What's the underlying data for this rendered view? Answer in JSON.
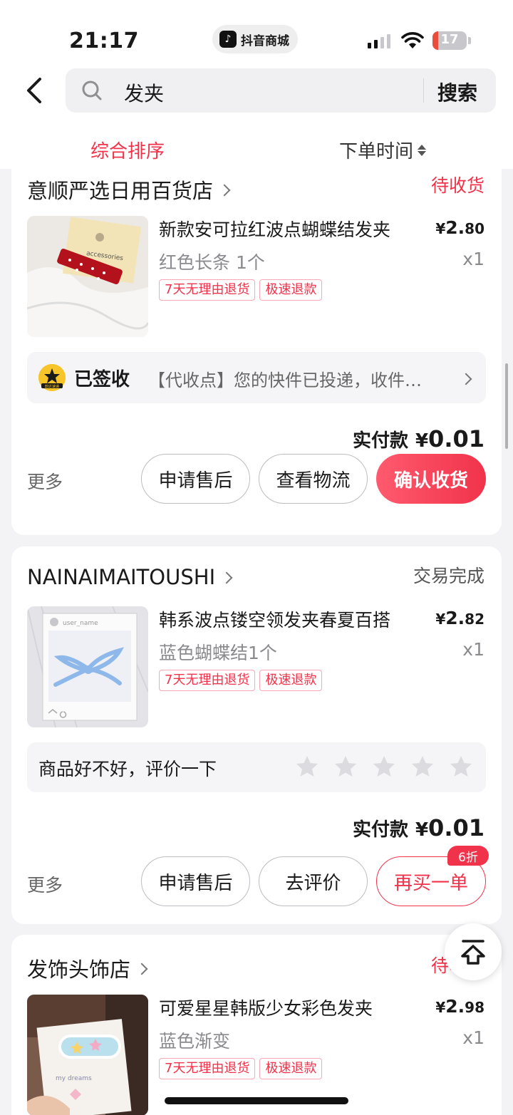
{
  "status_bar": {
    "time": "21:17",
    "app_name": "抖音商城",
    "battery": "17",
    "battery_level": 0.17
  },
  "search": {
    "keyword": "发夹",
    "button_label": "搜索"
  },
  "sort": {
    "comprehensive_label": "综合排序",
    "time_label": "下单时间"
  },
  "orders": [
    {
      "shop": "意顺严选日用百货店",
      "status": "待收货",
      "product_title": "新款安可拉红波点蝴蝶结发夹",
      "price_symbol": "¥",
      "price_int": "2.",
      "price_dec": "80",
      "spec": "红色长条 1个",
      "qty": "x1",
      "tags": [
        "7天无理由退货",
        "极速退款"
      ],
      "thumb_text": "accessories",
      "logistics": {
        "title": "已签收",
        "detail": "【代收点】您的快件已投递，收件人请及时取件",
        "courier_logo_text": "韵达速递"
      },
      "paid_label": "实付款",
      "paid_symbol": "¥",
      "paid_int": "0.",
      "paid_dec": "01",
      "more": "更多",
      "buttons": [
        "申请售后",
        "查看物流",
        "确认收货"
      ]
    },
    {
      "shop": "NAINAIMAITOUSHI",
      "status": "交易完成",
      "product_title": "韩系波点镂空领发夹春夏百搭",
      "price_symbol": "¥",
      "price_int": "2.",
      "price_dec": "82",
      "spec": "蓝色蝴蝶结1个",
      "qty": "x1",
      "tags": [
        "7天无理由退货",
        "极速退款"
      ],
      "thumb_text": "user_name",
      "review_prompt": "商品好不好，评价一下",
      "paid_label": "实付款",
      "paid_symbol": "¥",
      "paid_int": "0.",
      "paid_dec": "01",
      "more": "更多",
      "buttons": [
        "申请售后",
        "去评价",
        "再买一单"
      ],
      "discount_badge": "6折"
    },
    {
      "shop": "发饰头饰店",
      "status": "待收货",
      "product_title": "可爱星星韩版少女彩色发夹",
      "price_symbol": "¥",
      "price_int": "2.",
      "price_dec": "98",
      "spec": "蓝色渐变",
      "qty": "x1",
      "tags": [
        "7天无理由退货",
        "极速退款"
      ],
      "thumb_text": "my dreams"
    }
  ],
  "colors": {
    "accent": "#f0334b",
    "page_bg": "#f3f3f5"
  },
  "icons": [
    "back-arrow-icon",
    "search-icon",
    "sort-arrows-icon",
    "chevron-right-icon",
    "star-icon",
    "back-to-top-icon",
    "signal-icon",
    "wifi-icon",
    "battery-icon"
  ]
}
